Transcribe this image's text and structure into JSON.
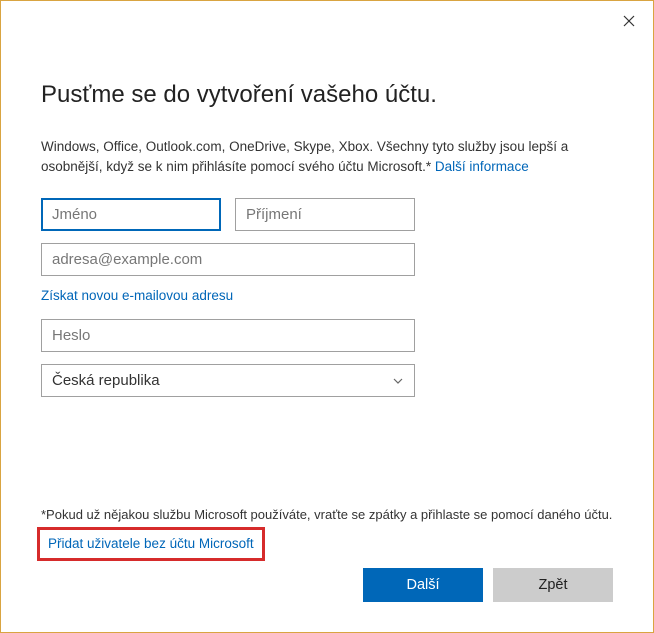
{
  "header": {
    "title": "Pusťme se do vytvoření vašeho účtu."
  },
  "intro": {
    "text": "Windows, Office, Outlook.com, OneDrive, Skype, Xbox. Všechny tyto služby jsou lepší a osobnější, když se k nim přihlásíte pomocí svého účtu Microsoft.* ",
    "link": "Další informace"
  },
  "fields": {
    "first_name_placeholder": "Jméno",
    "last_name_placeholder": "Příjmení",
    "email_placeholder": "adresa@example.com",
    "password_placeholder": "Heslo",
    "country_value": "Česká republika"
  },
  "links": {
    "new_email": "Získat novou e-mailovou adresu",
    "no_ms_account": "Přidat uživatele bez účtu Microsoft"
  },
  "footnote": "*Pokud už nějakou službu Microsoft používáte, vraťte se zpátky a přihlaste se pomocí daného účtu.",
  "buttons": {
    "next": "Další",
    "back": "Zpět"
  }
}
